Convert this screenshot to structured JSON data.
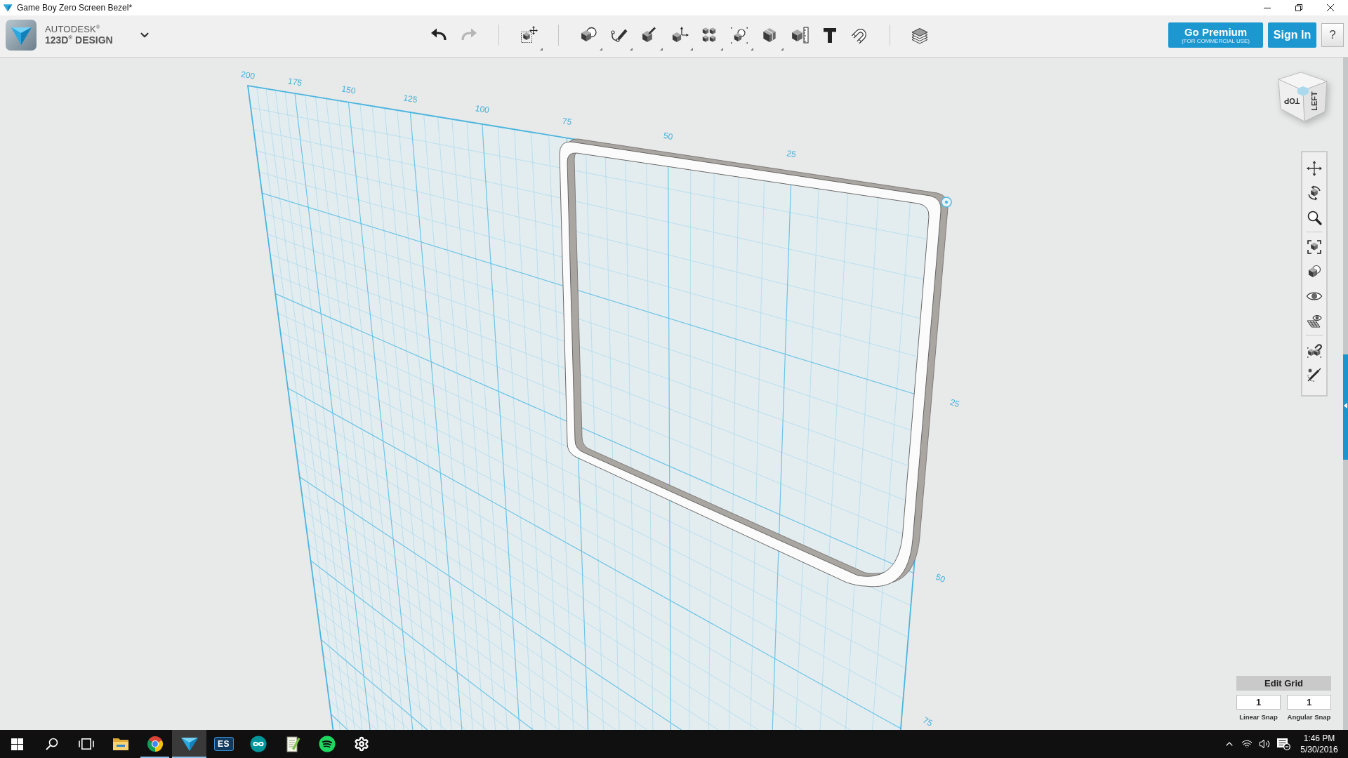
{
  "window": {
    "title": "Game Boy Zero Screen Bezel*"
  },
  "brand": {
    "maker": "AUTODESK$^{®}$",
    "product": "123D$^{®}$ DESIGN"
  },
  "toolbar_groups": [
    {
      "tools": [
        {
          "kind": "undo",
          "disabled": false,
          "has_menu": false
        },
        {
          "kind": "redo",
          "disabled": true,
          "has_menu": false
        }
      ]
    },
    {
      "tools": [
        {
          "kind": "transform",
          "disabled": false,
          "has_menu": true
        }
      ]
    },
    {
      "tools": [
        {
          "kind": "primitives",
          "disabled": false,
          "has_menu": true
        },
        {
          "kind": "sketch",
          "disabled": false,
          "has_menu": true
        },
        {
          "kind": "construct",
          "disabled": false,
          "has_menu": true
        },
        {
          "kind": "modify",
          "disabled": false,
          "has_menu": true
        },
        {
          "kind": "pattern",
          "disabled": false,
          "has_menu": true
        },
        {
          "kind": "grouping",
          "disabled": false,
          "has_menu": true
        },
        {
          "kind": "combine",
          "disabled": false,
          "has_menu": true
        },
        {
          "kind": "measure",
          "disabled": false,
          "has_menu": false
        },
        {
          "kind": "text",
          "disabled": false,
          "has_menu": false
        },
        {
          "kind": "snap",
          "disabled": false,
          "has_menu": false
        }
      ]
    },
    {
      "tools": [
        {
          "kind": "materials",
          "disabled": false,
          "has_menu": false
        }
      ]
    }
  ],
  "account": {
    "premium_button": {
      "label": "Go Premium",
      "note": "(FOR COMMERCIAL USE)"
    },
    "sign_in_button": "Sign In",
    "help_button": "?"
  },
  "view_cube": {
    "front_face": "TOP",
    "right_face": "LEFT"
  },
  "grid": {
    "top_ruler": [
      "200",
      "175",
      "150",
      "125",
      "100",
      "75",
      "50",
      "25"
    ],
    "side_ruler": [
      "25",
      "50",
      "75"
    ]
  },
  "grid_panel": {
    "title": "Edit Grid",
    "fields": [
      {
        "value": "1",
        "label": "Linear Snap"
      },
      {
        "value": "1",
        "label": "Angular Snap"
      }
    ]
  },
  "taskbar": {
    "apps": [
      {
        "kind": "folder",
        "running": false,
        "selected": false
      },
      {
        "kind": "browser",
        "running": true,
        "selected": false
      },
      {
        "kind": "modeler",
        "running": true,
        "selected": true
      },
      {
        "kind": "lettered",
        "letters": "ES",
        "running": false,
        "selected": false
      },
      {
        "kind": "infinity",
        "running": false,
        "selected": false
      },
      {
        "kind": "notepad",
        "running": false,
        "selected": false
      },
      {
        "kind": "music",
        "running": false,
        "selected": false
      },
      {
        "kind": "gear",
        "running": false,
        "selected": false
      }
    ],
    "clock": {
      "time": "1:46 PM",
      "date": "5/30/2016"
    }
  }
}
